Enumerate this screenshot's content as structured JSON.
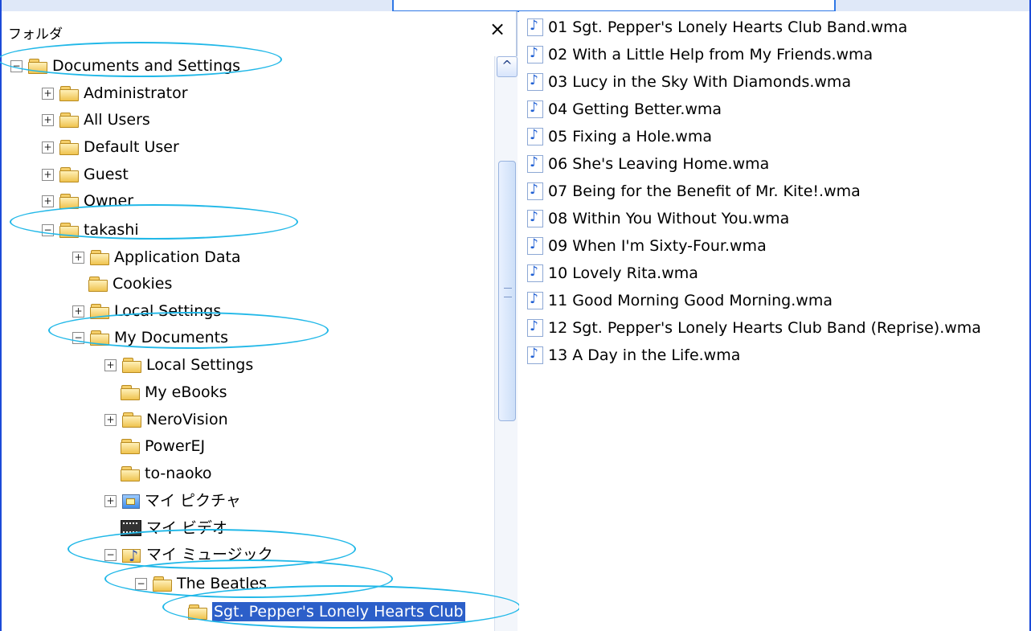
{
  "folder_pane": {
    "title": "フォルダ",
    "close": "×",
    "scroll_up": "^",
    "items": [
      {
        "label": "Documents and Settings",
        "expander": "−"
      },
      {
        "label": "Administrator",
        "expander": "+"
      },
      {
        "label": "All Users",
        "expander": "+"
      },
      {
        "label": "Default User",
        "expander": "+"
      },
      {
        "label": "Guest",
        "expander": "+"
      },
      {
        "label": "Owner",
        "expander": "+"
      },
      {
        "label": "takashi",
        "expander": "−"
      },
      {
        "label": "Application Data",
        "expander": "+"
      },
      {
        "label": "Cookies",
        "expander": ""
      },
      {
        "label": "Local Settings",
        "expander": "+"
      },
      {
        "label": "My Documents",
        "expander": "−"
      },
      {
        "label": "Local Settings",
        "expander": "+"
      },
      {
        "label": "My eBooks",
        "expander": ""
      },
      {
        "label": "NeroVision",
        "expander": "+"
      },
      {
        "label": "PowerEJ",
        "expander": ""
      },
      {
        "label": "to-naoko",
        "expander": ""
      },
      {
        "label": "マイ ピクチャ",
        "expander": "+"
      },
      {
        "label": "マイ ビデオ",
        "expander": ""
      },
      {
        "label": "マイ ミュージック",
        "expander": "−"
      },
      {
        "label": "The Beatles",
        "expander": "−"
      },
      {
        "label": "Sgt. Pepper's Lonely Hearts Club",
        "expander": ""
      }
    ]
  },
  "files": [
    "01 Sgt. Pepper's Lonely Hearts Club Band.wma",
    "02 With a Little Help from My Friends.wma",
    "03 Lucy in the Sky With Diamonds.wma",
    "04 Getting Better.wma",
    "05 Fixing a Hole.wma",
    "06 She's Leaving Home.wma",
    "07 Being for the Benefit of Mr. Kite!.wma",
    "08 Within You Without You.wma",
    "09 When I'm Sixty-Four.wma",
    "10 Lovely Rita.wma",
    "11 Good Morning Good Morning.wma",
    "12 Sgt. Pepper's Lonely Hearts Club Band (Reprise).wma",
    "13 A Day in the Life.wma"
  ],
  "icons": {
    "folder": "folder-icon",
    "pictures": "pictures-folder-icon",
    "videos": "videos-folder-icon",
    "music": "music-folder-icon",
    "audio_file": "audio-file-icon"
  },
  "colors": {
    "highlight_oval": "#21b8e8",
    "selection": "#2c5fc9",
    "frame": "#1c4ad8"
  }
}
